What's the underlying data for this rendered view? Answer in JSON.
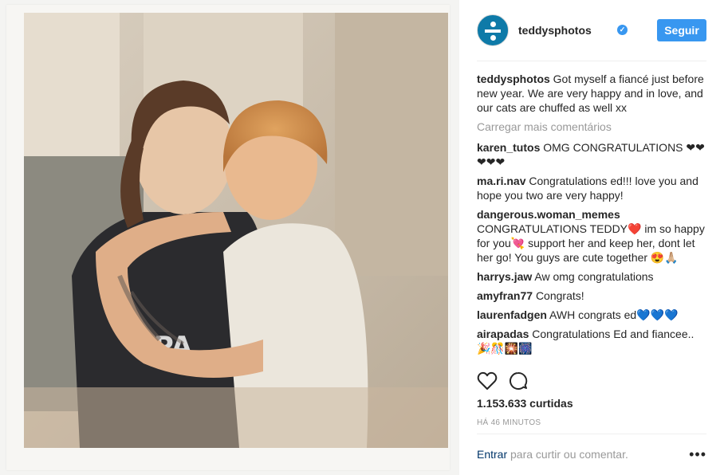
{
  "post": {
    "username": "teddysphotos",
    "verified_glyph": "✓",
    "follow_label": "Seguir",
    "caption": {
      "user": "teddysphotos",
      "text": "Got myself a fiancé just before new year. We are very happy and in love, and our cats are chuffed as well xx"
    },
    "load_more_label": "Carregar mais comentários",
    "comments": [
      {
        "user": "karen_tutos",
        "text": "OMG CONGRATULATIONS ❤❤❤❤❤"
      },
      {
        "user": "ma.ri.nav",
        "text": "Congratulations ed!!! love you and hope you two are very happy!"
      },
      {
        "user": "dangerous.woman_memes",
        "text": "CONGRATULATIONS TEDDY❤️ im so happy for you💘 support her and keep her, dont let her go! You guys are cute together 😍🙏🏼"
      },
      {
        "user": "harrys.jaw",
        "text": "Aw omg congratulations"
      },
      {
        "user": "amyfran77",
        "text": "Congrats!"
      },
      {
        "user": "laurenfadgen",
        "text": "AWH congrats ed💙💙💙"
      },
      {
        "user": "airapadas",
        "text": "Congratulations Ed and fiancee.. 🎉🎊🎇🎆"
      }
    ],
    "likes": "1.153.633 curtidas",
    "time_ago": "HÁ 46 MINUTOS",
    "footer": {
      "login_label": "Entrar",
      "prompt": "para curtir ou comentar.",
      "more_glyph": "•••"
    }
  },
  "icons": {
    "avatar": "divide-sign-logo",
    "like": "heart-outline-icon",
    "comment": "speech-bubble-icon",
    "more": "ellipsis-icon"
  },
  "colors": {
    "accent": "#3897f0",
    "avatar_bg": "#0e7aa8",
    "muted": "#999999",
    "text": "#262626"
  }
}
